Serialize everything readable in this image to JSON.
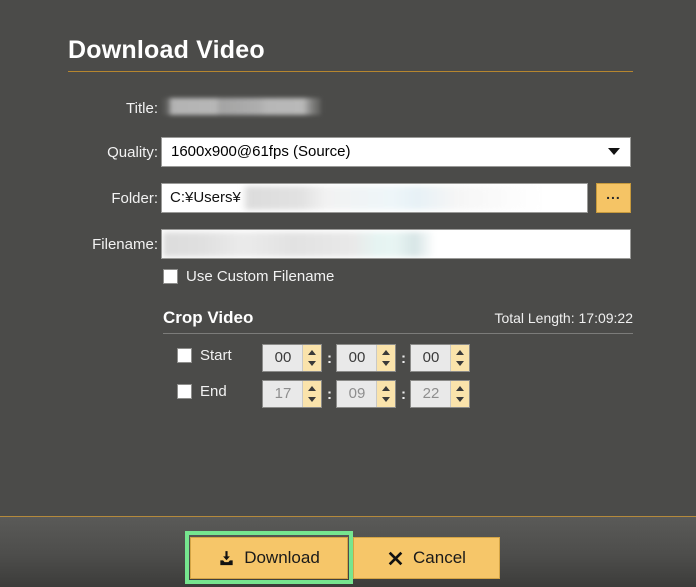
{
  "dialog": {
    "title": "Download Video"
  },
  "fields": {
    "title": {
      "label": "Title:",
      "value": "",
      "redacted": true
    },
    "quality": {
      "label": "Quality:",
      "value": "1600x900@61fps (Source)",
      "arrow_icon": "chevron-down-icon"
    },
    "folder": {
      "label": "Folder:",
      "value": "C:¥Users¥",
      "redacted": true,
      "browse_label": "...",
      "browse_icon": "ellipsis-icon"
    },
    "filename": {
      "label": "Filename:",
      "value": "",
      "redacted": true
    },
    "custom_filename": {
      "label": "Use Custom Filename",
      "checked": false
    }
  },
  "crop": {
    "section_label": "Crop Video",
    "total_length_label": "Total Length: 17:09:22",
    "separator": ":",
    "rows": [
      {
        "label": "Start",
        "checked": false,
        "dimmed": false,
        "hours": "00",
        "minutes": "00",
        "seconds": "00"
      },
      {
        "label": "End",
        "checked": false,
        "dimmed": true,
        "hours": "17",
        "minutes": "09",
        "seconds": "22"
      }
    ]
  },
  "footer": {
    "download_label": "Download",
    "download_icon": "download-tray-icon",
    "cancel_label": "Cancel",
    "cancel_icon": "close-x-icon"
  },
  "colors": {
    "background": "#4b4b49",
    "accent_orange": "#f5c465",
    "rule_orange": "#b6862f",
    "highlight_green": "#76e58f",
    "text": "#f2f2f2"
  }
}
